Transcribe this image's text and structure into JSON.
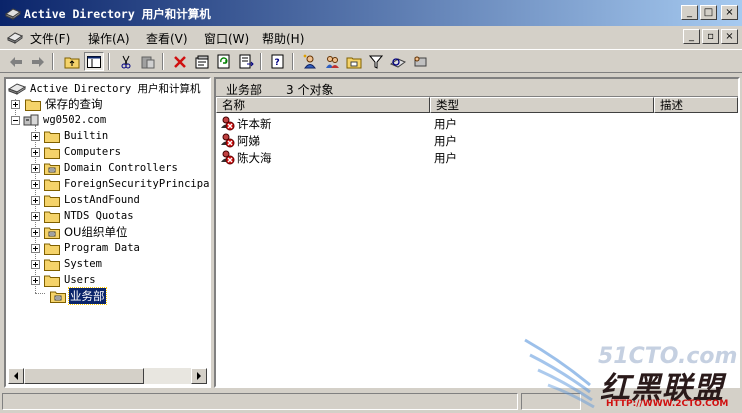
{
  "window": {
    "title": "Active Directory 用户和计算机",
    "minimize_glyph": "_",
    "maximize_glyph": "□",
    "close_glyph": "×",
    "restore_glyph": "▫"
  },
  "menu": {
    "items": [
      {
        "label": "文件(F)"
      },
      {
        "label": "操作(A)"
      },
      {
        "label": "查看(V)"
      },
      {
        "label": "窗口(W)"
      },
      {
        "label": "帮助(H)"
      }
    ]
  },
  "toolbar": {
    "icons": [
      "back-icon",
      "forward-icon",
      "up-folder-icon",
      "show-hide-tree-icon",
      "cut-icon",
      "paste-icon",
      "delete-icon",
      "properties-icon",
      "refresh-icon",
      "export-list-icon",
      "help-icon",
      "new-user-icon",
      "new-group-icon",
      "new-ou-icon",
      "filter-icon",
      "find-icon",
      "add-to-group-icon"
    ]
  },
  "tree": {
    "root": "Active Directory 用户和计算机",
    "saved_queries": "保存的查询",
    "domain": "wg0502.com",
    "children": [
      {
        "label": "Builtin",
        "kind": "folder"
      },
      {
        "label": "Computers",
        "kind": "folder"
      },
      {
        "label": "Domain Controllers",
        "kind": "ou"
      },
      {
        "label": "ForeignSecurityPrincipal",
        "kind": "folder"
      },
      {
        "label": "LostAndFound",
        "kind": "folder"
      },
      {
        "label": "NTDS Quotas",
        "kind": "folder"
      },
      {
        "label": "OU组织单位",
        "kind": "ou"
      },
      {
        "label": "Program Data",
        "kind": "folder"
      },
      {
        "label": "System",
        "kind": "folder"
      },
      {
        "label": "Users",
        "kind": "folder"
      },
      {
        "label": "业务部",
        "kind": "ou"
      }
    ],
    "selected": "业务部"
  },
  "list": {
    "ou_name": "业务部",
    "object_count": "3 个对象",
    "columns": [
      "名称",
      "类型",
      "描述"
    ],
    "rows": [
      {
        "name": "许本新",
        "type": "用户"
      },
      {
        "name": "阿娣",
        "type": "用户"
      },
      {
        "name": "陈大海",
        "type": "用户"
      }
    ]
  },
  "watermark": {
    "site": "51CTO.com",
    "brand": "红黑联盟",
    "url": "HTTP://WWW.2CTO.COM"
  },
  "colors": {
    "titlebar_start": "#0a246a",
    "titlebar_end": "#a6caf0",
    "face": "#d4d0c8",
    "selection": "#0a246a",
    "disabled_user_x": "#d01010",
    "folder": "#f5d36a"
  }
}
